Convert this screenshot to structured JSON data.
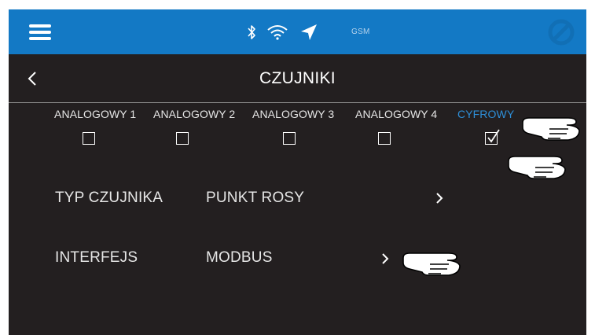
{
  "status_bar": {
    "gsm_label": "GSM",
    "icons": [
      "bluetooth-icon",
      "wifi-icon",
      "location-arrow-icon"
    ]
  },
  "header": {
    "title": "CZUJNIKI"
  },
  "sensor_tabs": [
    {
      "label": "ANALOGOWY 1",
      "checked": false
    },
    {
      "label": "ANALOGOWY 2",
      "checked": false
    },
    {
      "label": "ANALOGOWY 3",
      "checked": false
    },
    {
      "label": "ANALOGOWY 4",
      "checked": false
    },
    {
      "label": "CYFROWY",
      "checked": true
    }
  ],
  "settings": [
    {
      "label": "TYP CZUJNIKA",
      "value": "PUNKT ROSY"
    },
    {
      "label": "INTERFEJS",
      "value": "MODBUS"
    }
  ],
  "colors": {
    "accent": "#1379c5",
    "active_tab": "#2e8fd8",
    "background": "#231f20",
    "text": "#e6e6e6"
  }
}
